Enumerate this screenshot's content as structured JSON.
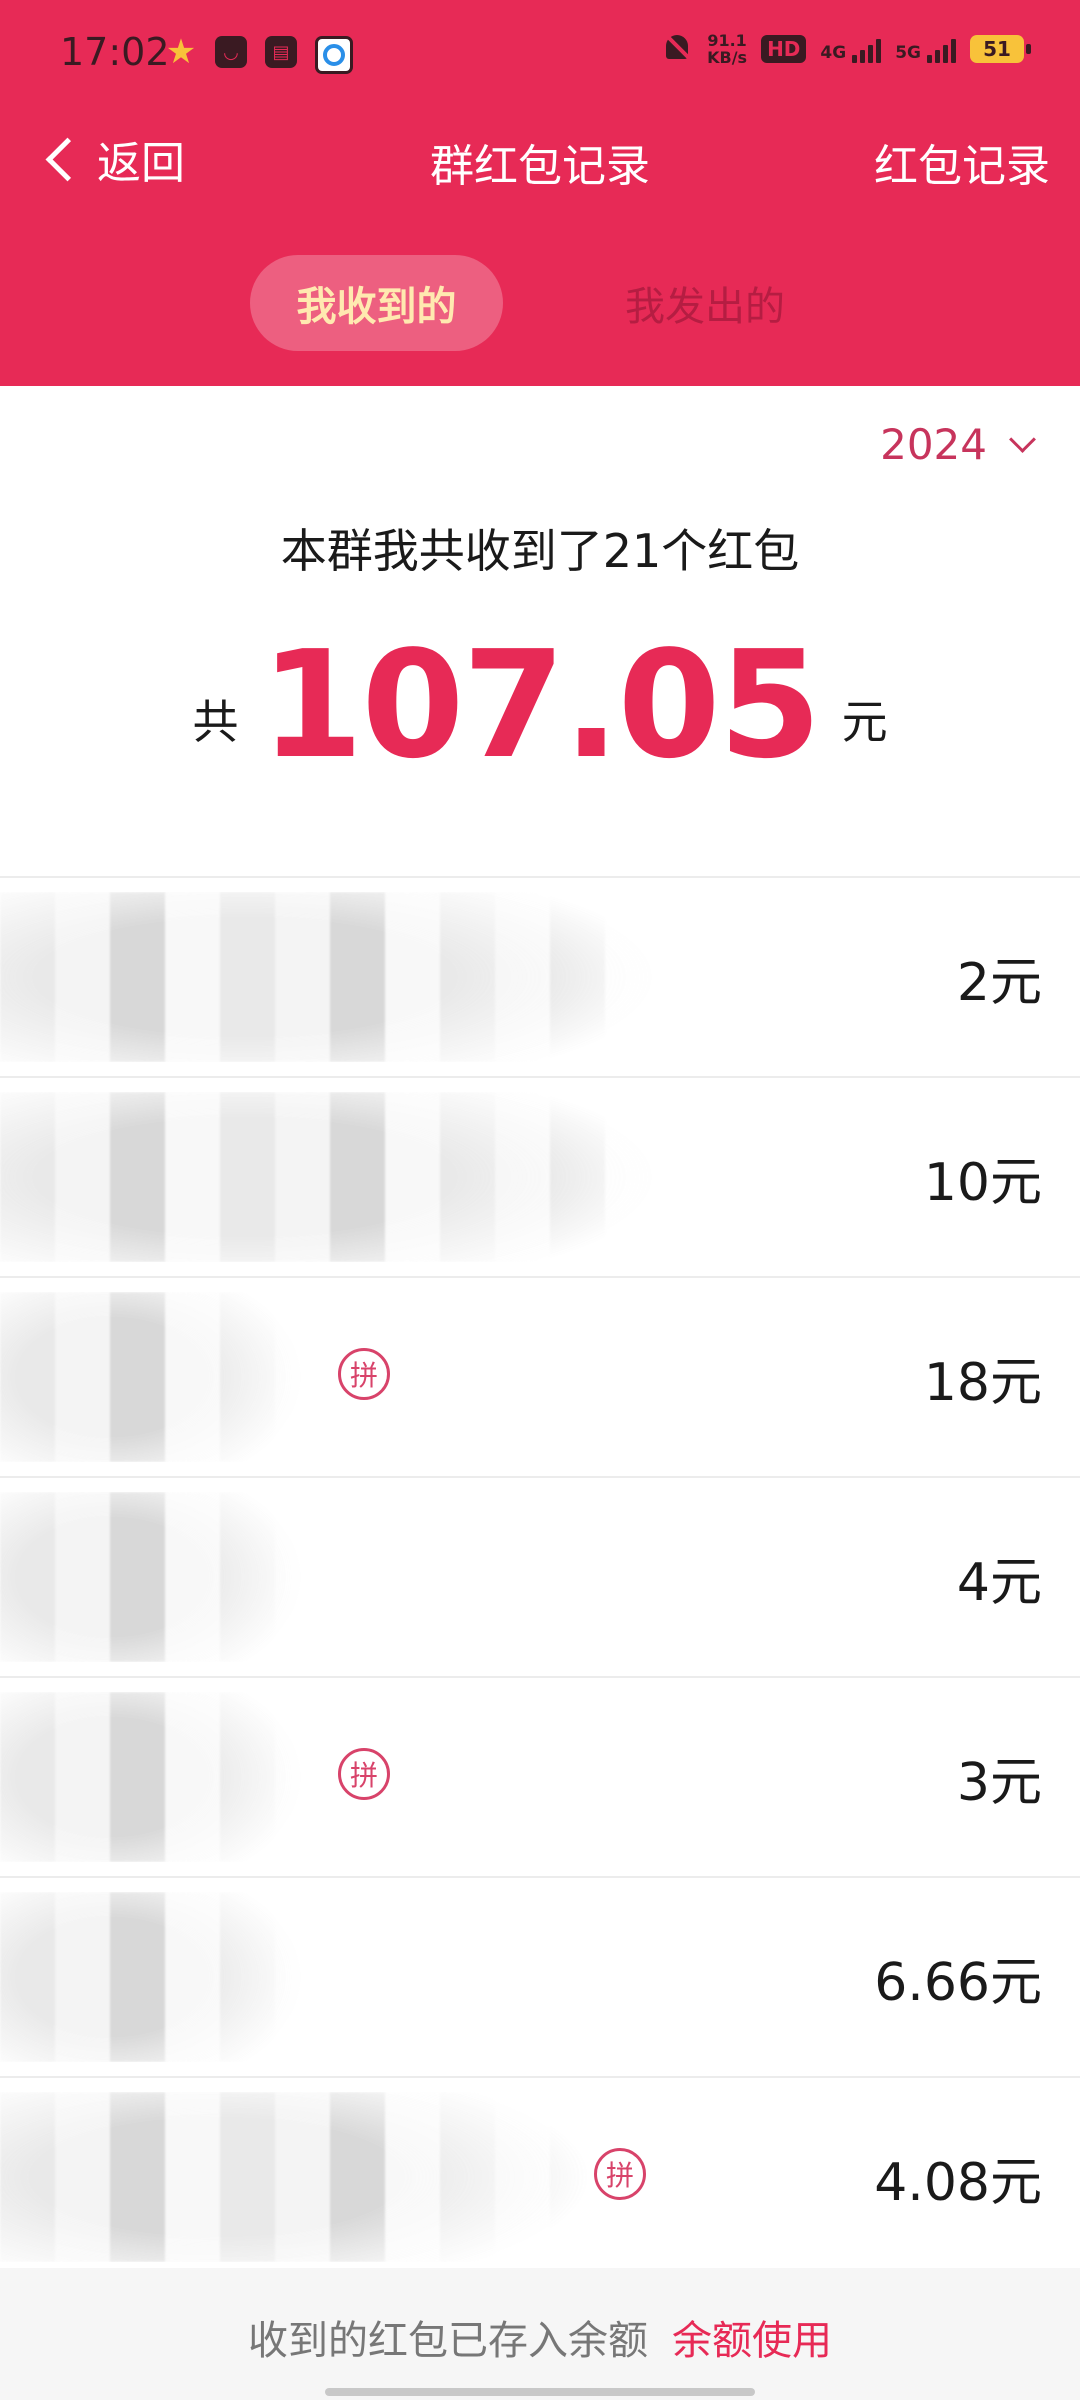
{
  "status_bar": {
    "time": "17:02",
    "net_speed_value": "91.1",
    "net_speed_unit": "KB/s",
    "hd_badge": "HD",
    "network_1": "4G",
    "network_2": "5G",
    "battery": "51",
    "notification_icons": [
      "star-icon",
      "mail-icon",
      "card-icon",
      "browser-icon"
    ]
  },
  "nav": {
    "back_label": "返回",
    "title": "群红包记录",
    "right_label": "红包记录"
  },
  "tabs": [
    {
      "label": "我收到的",
      "active": true
    },
    {
      "label": "我发出的",
      "active": false
    }
  ],
  "year_filter": {
    "selected": "2024"
  },
  "summary": {
    "text": "本群我共收到了21个红包",
    "prefix": "共",
    "amount": "107.05",
    "unit": "元"
  },
  "records": [
    {
      "amount": "2元",
      "pin_badge": ""
    },
    {
      "amount": "10元",
      "pin_badge": ""
    },
    {
      "amount": "18元",
      "pin_badge": "拼"
    },
    {
      "amount": "4元",
      "pin_badge": ""
    },
    {
      "amount": "3元",
      "pin_badge": "拼"
    },
    {
      "amount": "6.66元",
      "pin_badge": ""
    },
    {
      "amount": "4.08元",
      "pin_badge": "拼"
    }
  ],
  "footer": {
    "note": "收到的红包已存入余额",
    "link": "余额使用"
  },
  "colors": {
    "brand_red": "#e72a56",
    "active_tab_text": "#ffe9b0",
    "accent_pink": "#c7345c"
  }
}
